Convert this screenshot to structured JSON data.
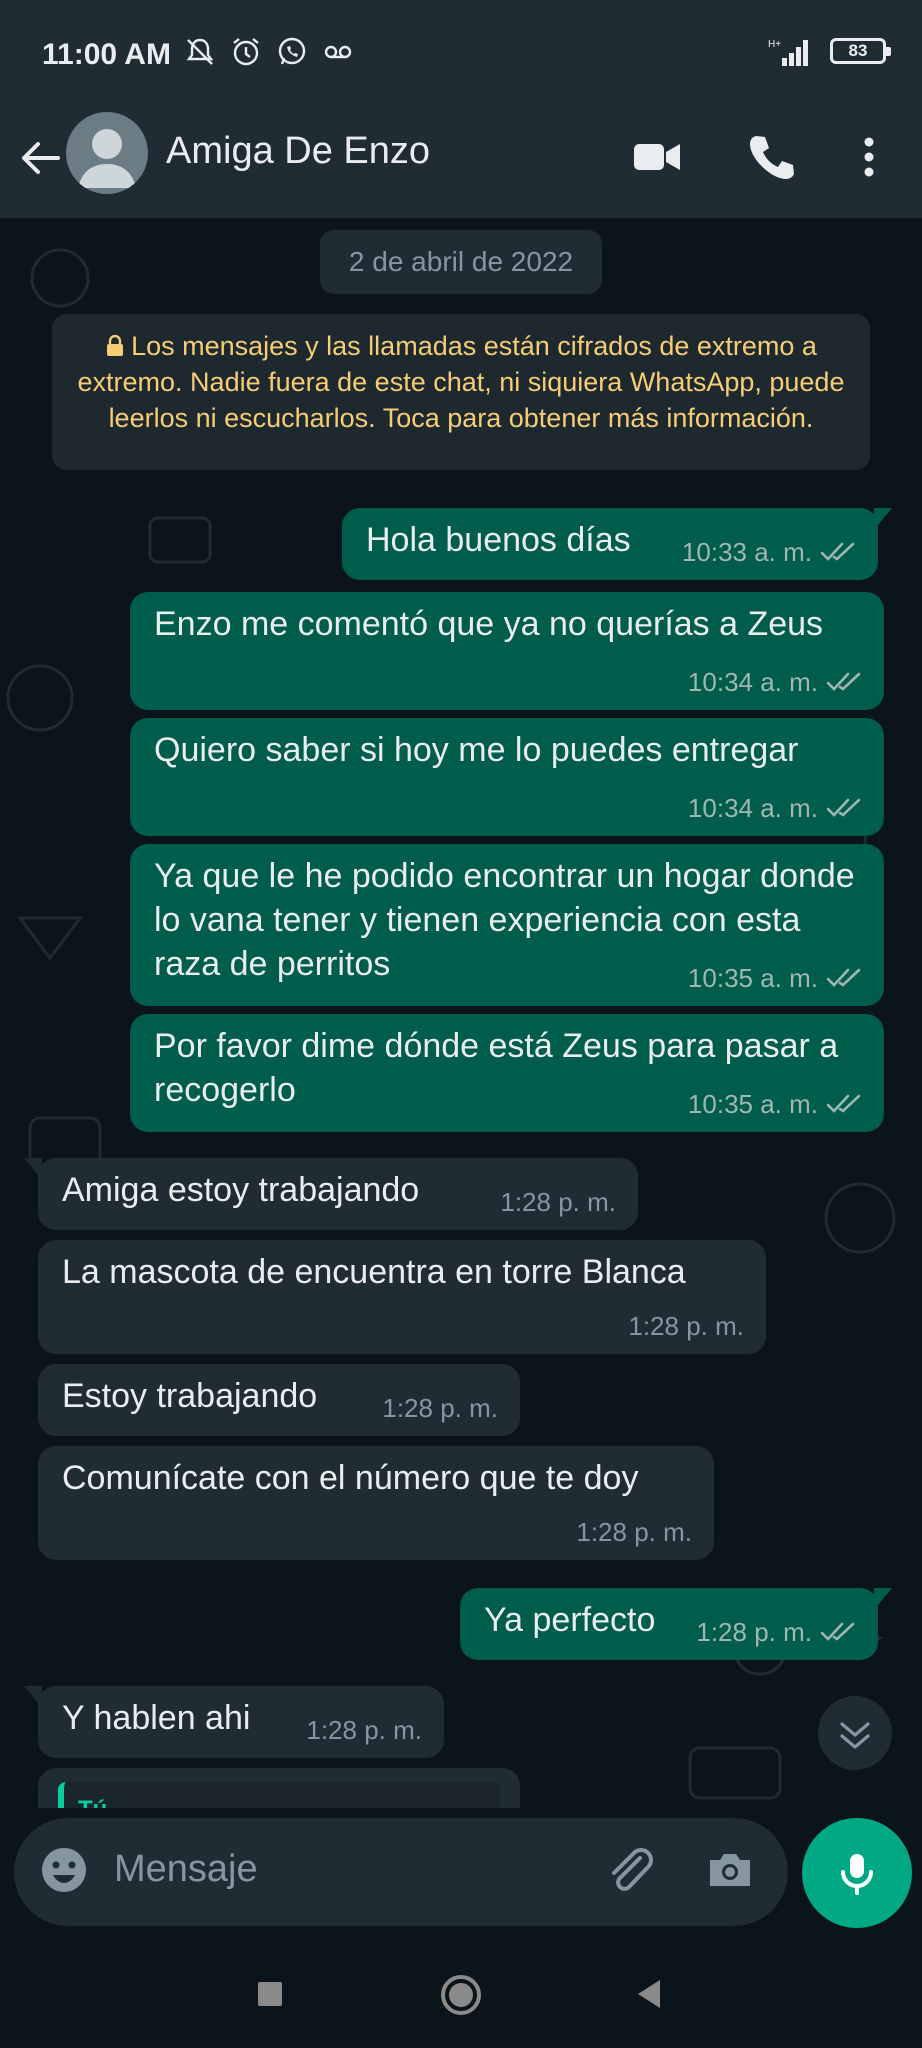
{
  "status_bar": {
    "time": "11:00 AM",
    "battery": "83"
  },
  "header": {
    "contact_name": "Amiga De Enzo"
  },
  "chat": {
    "date_chip": "2 de abril de 2022",
    "encryption_notice": "Los mensajes y las llamadas están cifrados de extremo a extremo. Nadie fuera de este chat, ni siquiera WhatsApp, puede leerlos ni escucharlos. Toca para obtener más información.",
    "messages": [
      {
        "dir": "out",
        "text": "Hola buenos días",
        "time": "10:33 a. m."
      },
      {
        "dir": "out",
        "text": "Enzo me comentó que ya no querías a Zeus",
        "time": "10:34 a. m."
      },
      {
        "dir": "out",
        "text": "Quiero saber si hoy me lo puedes entregar",
        "time": "10:34 a. m."
      },
      {
        "dir": "out",
        "text": "Ya que le he podido encontrar un hogar donde lo vana tener y tienen experiencia con esta raza de perritos",
        "time": "10:35 a. m."
      },
      {
        "dir": "out",
        "text": "Por favor dime dónde está Zeus para pasar a recogerlo",
        "time": "10:35 a. m."
      },
      {
        "dir": "in",
        "text": "Amiga estoy trabajando",
        "time": "1:28 p. m."
      },
      {
        "dir": "in",
        "text": "La mascota de encuentra en torre Blanca",
        "time": "1:28 p. m."
      },
      {
        "dir": "in",
        "text": "Estoy trabajando",
        "time": "1:28 p. m."
      },
      {
        "dir": "in",
        "text": "Comunícate con el número que te doy",
        "time": "1:28 p. m."
      },
      {
        "dir": "out",
        "text": "Ya perfecto",
        "time": "1:28 p. m."
      },
      {
        "dir": "in",
        "text": "Y hablen ahi",
        "time": "1:28 p. m."
      },
      {
        "dir": "in",
        "text": "Tú",
        "time": ""
      }
    ]
  },
  "composer": {
    "placeholder": "Mensaje"
  },
  "colors": {
    "outgoing": "#005c4b",
    "incoming": "#1f2c34",
    "accent": "#00a884",
    "notice": "#f7cd73"
  },
  "icons": [
    "back-arrow-icon",
    "video-call-icon",
    "voice-call-icon",
    "more-options-icon",
    "lock-icon",
    "double-check-icon",
    "chevron-down-icon",
    "emoji-icon",
    "paperclip-icon",
    "camera-icon",
    "mic-icon"
  ]
}
